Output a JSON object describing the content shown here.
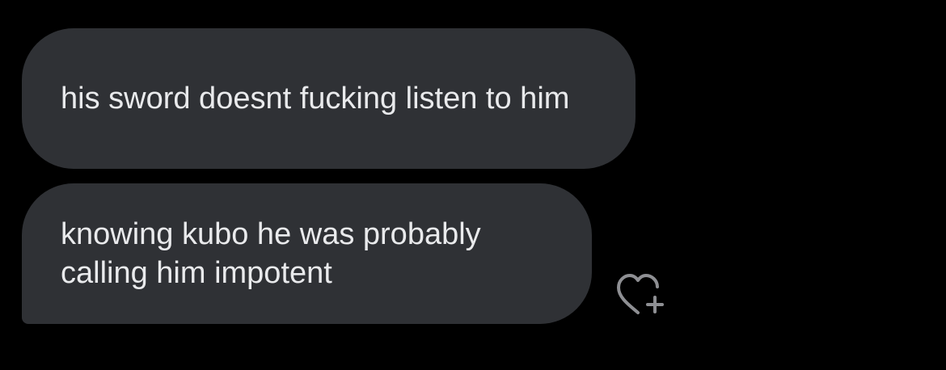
{
  "messages": [
    {
      "sender": "other",
      "text": "his sword doesnt fucking listen to him"
    },
    {
      "sender": "other",
      "text": "knowing kubo he was probably calling him impotent"
    }
  ],
  "reaction_button": {
    "icon": "heart-plus-icon",
    "color": "#8e8f93"
  },
  "colors": {
    "background": "#000000",
    "bubble": "#2f3135",
    "text": "#e9eaec"
  }
}
